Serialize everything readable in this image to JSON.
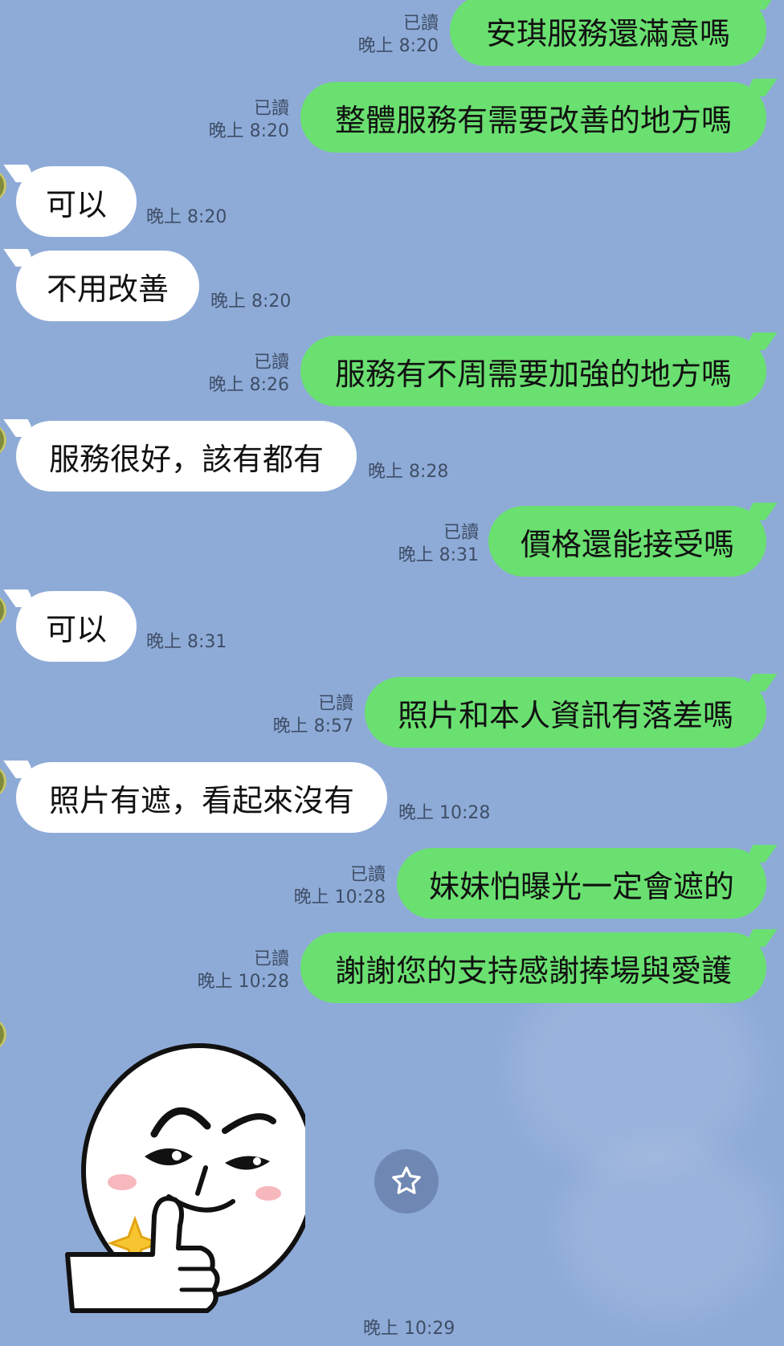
{
  "messages": [
    {
      "dir": "out",
      "text": "安琪服務還滿意嗎",
      "read": "已讀",
      "time": "晚上 8:20"
    },
    {
      "dir": "out",
      "text": "整體服務有需要改善的地方嗎",
      "read": "已讀",
      "time": "晚上 8:20"
    },
    {
      "dir": "in",
      "text": "可以",
      "time": "晚上 8:20"
    },
    {
      "dir": "in",
      "text": "不用改善",
      "time": "晚上 8:20"
    },
    {
      "dir": "out",
      "text": "服務有不周需要加強的地方嗎",
      "read": "已讀",
      "time": "晚上 8:26"
    },
    {
      "dir": "in",
      "text": "服務很好，該有都有",
      "time": "晚上 8:28"
    },
    {
      "dir": "out",
      "text": "價格還能接受嗎",
      "read": "已讀",
      "time": "晚上 8:31"
    },
    {
      "dir": "in",
      "text": "可以",
      "time": "晚上 8:31"
    },
    {
      "dir": "out",
      "text": "照片和本人資訊有落差嗎",
      "read": "已讀",
      "time": "晚上 8:57"
    },
    {
      "dir": "in",
      "text": "照片有遮，看起來沒有",
      "time": "晚上 10:28"
    },
    {
      "dir": "out",
      "text": "妹妹怕曝光一定會遮的",
      "read": "已讀",
      "time": "晚上 10:28"
    },
    {
      "dir": "out",
      "text": "謝謝您的支持感謝捧場與愛護",
      "read": "已讀",
      "time": "晚上 10:28"
    }
  ],
  "sticker": {
    "icon": "thumbs-up-moon-sticker",
    "time": "晚上 10:29"
  },
  "star_button": {
    "icon": "star-icon"
  },
  "colors": {
    "background": "#8eabd8",
    "outgoing": "#6ae070",
    "incoming": "#ffffff",
    "meta": "#3f4e66"
  }
}
